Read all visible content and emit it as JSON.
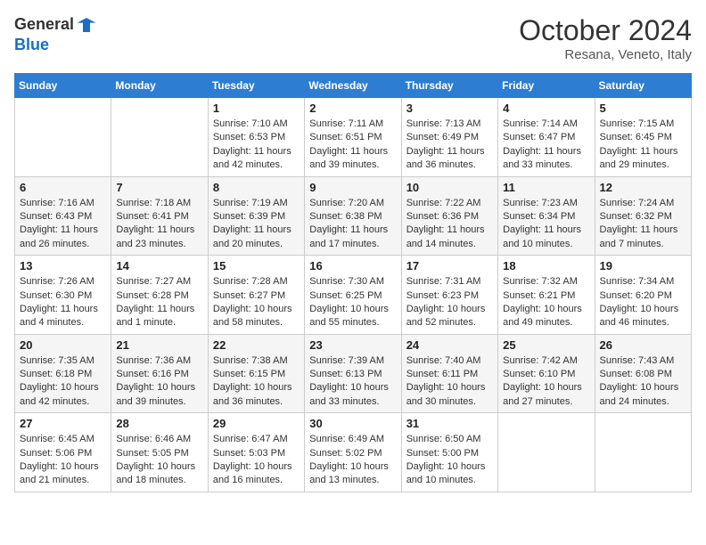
{
  "header": {
    "logo_line1": "General",
    "logo_line2": "Blue",
    "month": "October 2024",
    "location": "Resana, Veneto, Italy"
  },
  "days_of_week": [
    "Sunday",
    "Monday",
    "Tuesday",
    "Wednesday",
    "Thursday",
    "Friday",
    "Saturday"
  ],
  "weeks": [
    [
      null,
      null,
      {
        "day": 1,
        "sunrise": "Sunrise: 7:10 AM",
        "sunset": "Sunset: 6:53 PM",
        "daylight": "Daylight: 11 hours and 42 minutes."
      },
      {
        "day": 2,
        "sunrise": "Sunrise: 7:11 AM",
        "sunset": "Sunset: 6:51 PM",
        "daylight": "Daylight: 11 hours and 39 minutes."
      },
      {
        "day": 3,
        "sunrise": "Sunrise: 7:13 AM",
        "sunset": "Sunset: 6:49 PM",
        "daylight": "Daylight: 11 hours and 36 minutes."
      },
      {
        "day": 4,
        "sunrise": "Sunrise: 7:14 AM",
        "sunset": "Sunset: 6:47 PM",
        "daylight": "Daylight: 11 hours and 33 minutes."
      },
      {
        "day": 5,
        "sunrise": "Sunrise: 7:15 AM",
        "sunset": "Sunset: 6:45 PM",
        "daylight": "Daylight: 11 hours and 29 minutes."
      }
    ],
    [
      {
        "day": 6,
        "sunrise": "Sunrise: 7:16 AM",
        "sunset": "Sunset: 6:43 PM",
        "daylight": "Daylight: 11 hours and 26 minutes."
      },
      {
        "day": 7,
        "sunrise": "Sunrise: 7:18 AM",
        "sunset": "Sunset: 6:41 PM",
        "daylight": "Daylight: 11 hours and 23 minutes."
      },
      {
        "day": 8,
        "sunrise": "Sunrise: 7:19 AM",
        "sunset": "Sunset: 6:39 PM",
        "daylight": "Daylight: 11 hours and 20 minutes."
      },
      {
        "day": 9,
        "sunrise": "Sunrise: 7:20 AM",
        "sunset": "Sunset: 6:38 PM",
        "daylight": "Daylight: 11 hours and 17 minutes."
      },
      {
        "day": 10,
        "sunrise": "Sunrise: 7:22 AM",
        "sunset": "Sunset: 6:36 PM",
        "daylight": "Daylight: 11 hours and 14 minutes."
      },
      {
        "day": 11,
        "sunrise": "Sunrise: 7:23 AM",
        "sunset": "Sunset: 6:34 PM",
        "daylight": "Daylight: 11 hours and 10 minutes."
      },
      {
        "day": 12,
        "sunrise": "Sunrise: 7:24 AM",
        "sunset": "Sunset: 6:32 PM",
        "daylight": "Daylight: 11 hours and 7 minutes."
      }
    ],
    [
      {
        "day": 13,
        "sunrise": "Sunrise: 7:26 AM",
        "sunset": "Sunset: 6:30 PM",
        "daylight": "Daylight: 11 hours and 4 minutes."
      },
      {
        "day": 14,
        "sunrise": "Sunrise: 7:27 AM",
        "sunset": "Sunset: 6:28 PM",
        "daylight": "Daylight: 11 hours and 1 minute."
      },
      {
        "day": 15,
        "sunrise": "Sunrise: 7:28 AM",
        "sunset": "Sunset: 6:27 PM",
        "daylight": "Daylight: 10 hours and 58 minutes."
      },
      {
        "day": 16,
        "sunrise": "Sunrise: 7:30 AM",
        "sunset": "Sunset: 6:25 PM",
        "daylight": "Daylight: 10 hours and 55 minutes."
      },
      {
        "day": 17,
        "sunrise": "Sunrise: 7:31 AM",
        "sunset": "Sunset: 6:23 PM",
        "daylight": "Daylight: 10 hours and 52 minutes."
      },
      {
        "day": 18,
        "sunrise": "Sunrise: 7:32 AM",
        "sunset": "Sunset: 6:21 PM",
        "daylight": "Daylight: 10 hours and 49 minutes."
      },
      {
        "day": 19,
        "sunrise": "Sunrise: 7:34 AM",
        "sunset": "Sunset: 6:20 PM",
        "daylight": "Daylight: 10 hours and 46 minutes."
      }
    ],
    [
      {
        "day": 20,
        "sunrise": "Sunrise: 7:35 AM",
        "sunset": "Sunset: 6:18 PM",
        "daylight": "Daylight: 10 hours and 42 minutes."
      },
      {
        "day": 21,
        "sunrise": "Sunrise: 7:36 AM",
        "sunset": "Sunset: 6:16 PM",
        "daylight": "Daylight: 10 hours and 39 minutes."
      },
      {
        "day": 22,
        "sunrise": "Sunrise: 7:38 AM",
        "sunset": "Sunset: 6:15 PM",
        "daylight": "Daylight: 10 hours and 36 minutes."
      },
      {
        "day": 23,
        "sunrise": "Sunrise: 7:39 AM",
        "sunset": "Sunset: 6:13 PM",
        "daylight": "Daylight: 10 hours and 33 minutes."
      },
      {
        "day": 24,
        "sunrise": "Sunrise: 7:40 AM",
        "sunset": "Sunset: 6:11 PM",
        "daylight": "Daylight: 10 hours and 30 minutes."
      },
      {
        "day": 25,
        "sunrise": "Sunrise: 7:42 AM",
        "sunset": "Sunset: 6:10 PM",
        "daylight": "Daylight: 10 hours and 27 minutes."
      },
      {
        "day": 26,
        "sunrise": "Sunrise: 7:43 AM",
        "sunset": "Sunset: 6:08 PM",
        "daylight": "Daylight: 10 hours and 24 minutes."
      }
    ],
    [
      {
        "day": 27,
        "sunrise": "Sunrise: 6:45 AM",
        "sunset": "Sunset: 5:06 PM",
        "daylight": "Daylight: 10 hours and 21 minutes."
      },
      {
        "day": 28,
        "sunrise": "Sunrise: 6:46 AM",
        "sunset": "Sunset: 5:05 PM",
        "daylight": "Daylight: 10 hours and 18 minutes."
      },
      {
        "day": 29,
        "sunrise": "Sunrise: 6:47 AM",
        "sunset": "Sunset: 5:03 PM",
        "daylight": "Daylight: 10 hours and 16 minutes."
      },
      {
        "day": 30,
        "sunrise": "Sunrise: 6:49 AM",
        "sunset": "Sunset: 5:02 PM",
        "daylight": "Daylight: 10 hours and 13 minutes."
      },
      {
        "day": 31,
        "sunrise": "Sunrise: 6:50 AM",
        "sunset": "Sunset: 5:00 PM",
        "daylight": "Daylight: 10 hours and 10 minutes."
      },
      null,
      null
    ]
  ]
}
